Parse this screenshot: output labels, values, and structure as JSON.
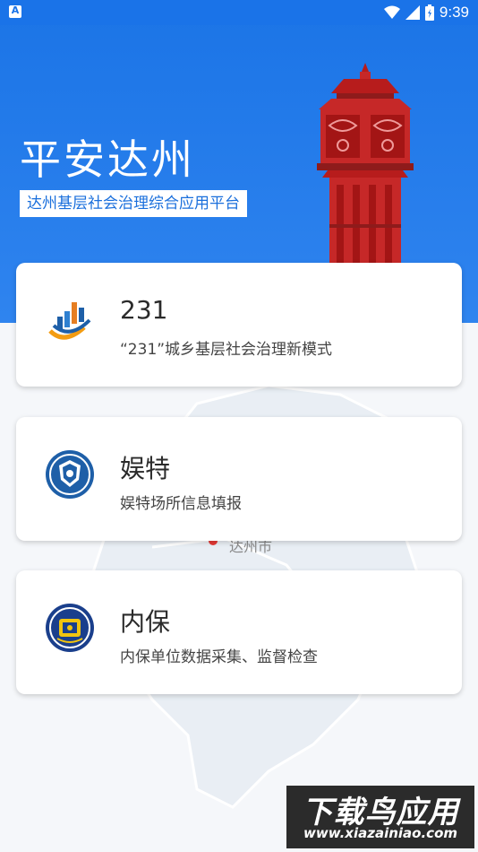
{
  "status_bar": {
    "notification_letter": "A",
    "time": "9:39",
    "icons": [
      "wifi-icon",
      "signal-icon",
      "battery-icon"
    ]
  },
  "header": {
    "title": "平安达州",
    "subtitle": "达州基层社会治理综合应用平台"
  },
  "cards": [
    {
      "title": "231",
      "description": "“231”城乡基层社会治理新模式",
      "icon": "bar-chart-logo-icon"
    },
    {
      "title": "娱特",
      "description": "娱特场所信息填报",
      "icon": "police-badge-icon"
    },
    {
      "title": "内保",
      "description": "内保单位数据采集、监督检查",
      "icon": "police-emblem-icon"
    }
  ],
  "map": {
    "label": "达州市"
  },
  "watermark": {
    "title": "下载鸟应用",
    "url": "www.xiazainiao.com"
  },
  "colors": {
    "primary": "#1b74e6",
    "card_bg": "#ffffff",
    "page_bg": "#f5f7fa",
    "tower_red": "#c62828"
  }
}
